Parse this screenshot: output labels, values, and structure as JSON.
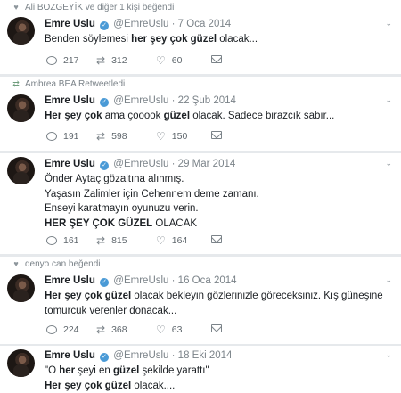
{
  "tweets": [
    {
      "context": "Ali BOZGEYİK ve diğer 1 kişi beğendi",
      "context_icon": "heart-icon",
      "name": "Emre Uslu",
      "handle": "@EmreUslu",
      "date": "· 7 Oca 2014",
      "lines": [
        [
          {
            "t": "Benden söylemesi "
          },
          {
            "t": "her şey çok güzel",
            "b": true
          },
          {
            "t": " olacak..."
          }
        ]
      ],
      "replies": "217",
      "retweets": "312",
      "likes": "60"
    },
    {
      "context": "Ambrea BEA Retweetledi",
      "context_icon": "retweet-icon",
      "name": "Emre Uslu",
      "handle": "@EmreUslu",
      "date": "· 22 Şub 2014",
      "lines": [
        [
          {
            "t": "Her şey çok",
            "b": true
          },
          {
            "t": " ama çooook "
          },
          {
            "t": "güzel",
            "b": true
          },
          {
            "t": " olacak. Sadece birazcık sabır..."
          }
        ]
      ],
      "replies": "191",
      "retweets": "598",
      "likes": "150"
    },
    {
      "context": "",
      "name": "Emre Uslu",
      "handle": "@EmreUslu",
      "date": "· 29 Mar 2014",
      "lines": [
        [
          {
            "t": "Önder Aytaç gözaltına alınmış."
          }
        ],
        [
          {
            "t": "Yaşasın Zalimler için Cehennem deme zamanı."
          }
        ],
        [
          {
            "t": "Enseyi karatmayın oyunuzu verin."
          }
        ],
        [
          {
            "t": "HER ŞEY ÇOK GÜZEL",
            "b": true
          },
          {
            "t": " OLACAK"
          }
        ]
      ],
      "replies": "161",
      "retweets": "815",
      "likes": "164"
    },
    {
      "context": "denyo can beğendi",
      "context_icon": "heart-icon",
      "name": "Emre Uslu",
      "handle": "@EmreUslu",
      "date": "· 16 Oca 2014",
      "lines": [
        [
          {
            "t": "Her şey çok güzel",
            "b": true
          },
          {
            "t": " olacak bekleyin gözlerinizle göreceksiniz. Kış güneşine"
          }
        ],
        [
          {
            "t": "tomurcuk verenler donacak..."
          }
        ]
      ],
      "replies": "224",
      "retweets": "368",
      "likes": "63"
    },
    {
      "context": "",
      "name": "Emre Uslu",
      "handle": "@EmreUslu",
      "date": "· 18 Eki 2014",
      "lines": [
        [
          {
            "t": "\"O "
          },
          {
            "t": "her",
            "b": true
          },
          {
            "t": " şeyi en "
          },
          {
            "t": "güzel",
            "b": true
          },
          {
            "t": " şekilde yarattı\""
          }
        ],
        [
          {
            "t": "Her şey çok güzel",
            "b": true
          },
          {
            "t": " olacak...."
          }
        ]
      ],
      "replies": "",
      "retweets": "",
      "likes": ""
    }
  ]
}
